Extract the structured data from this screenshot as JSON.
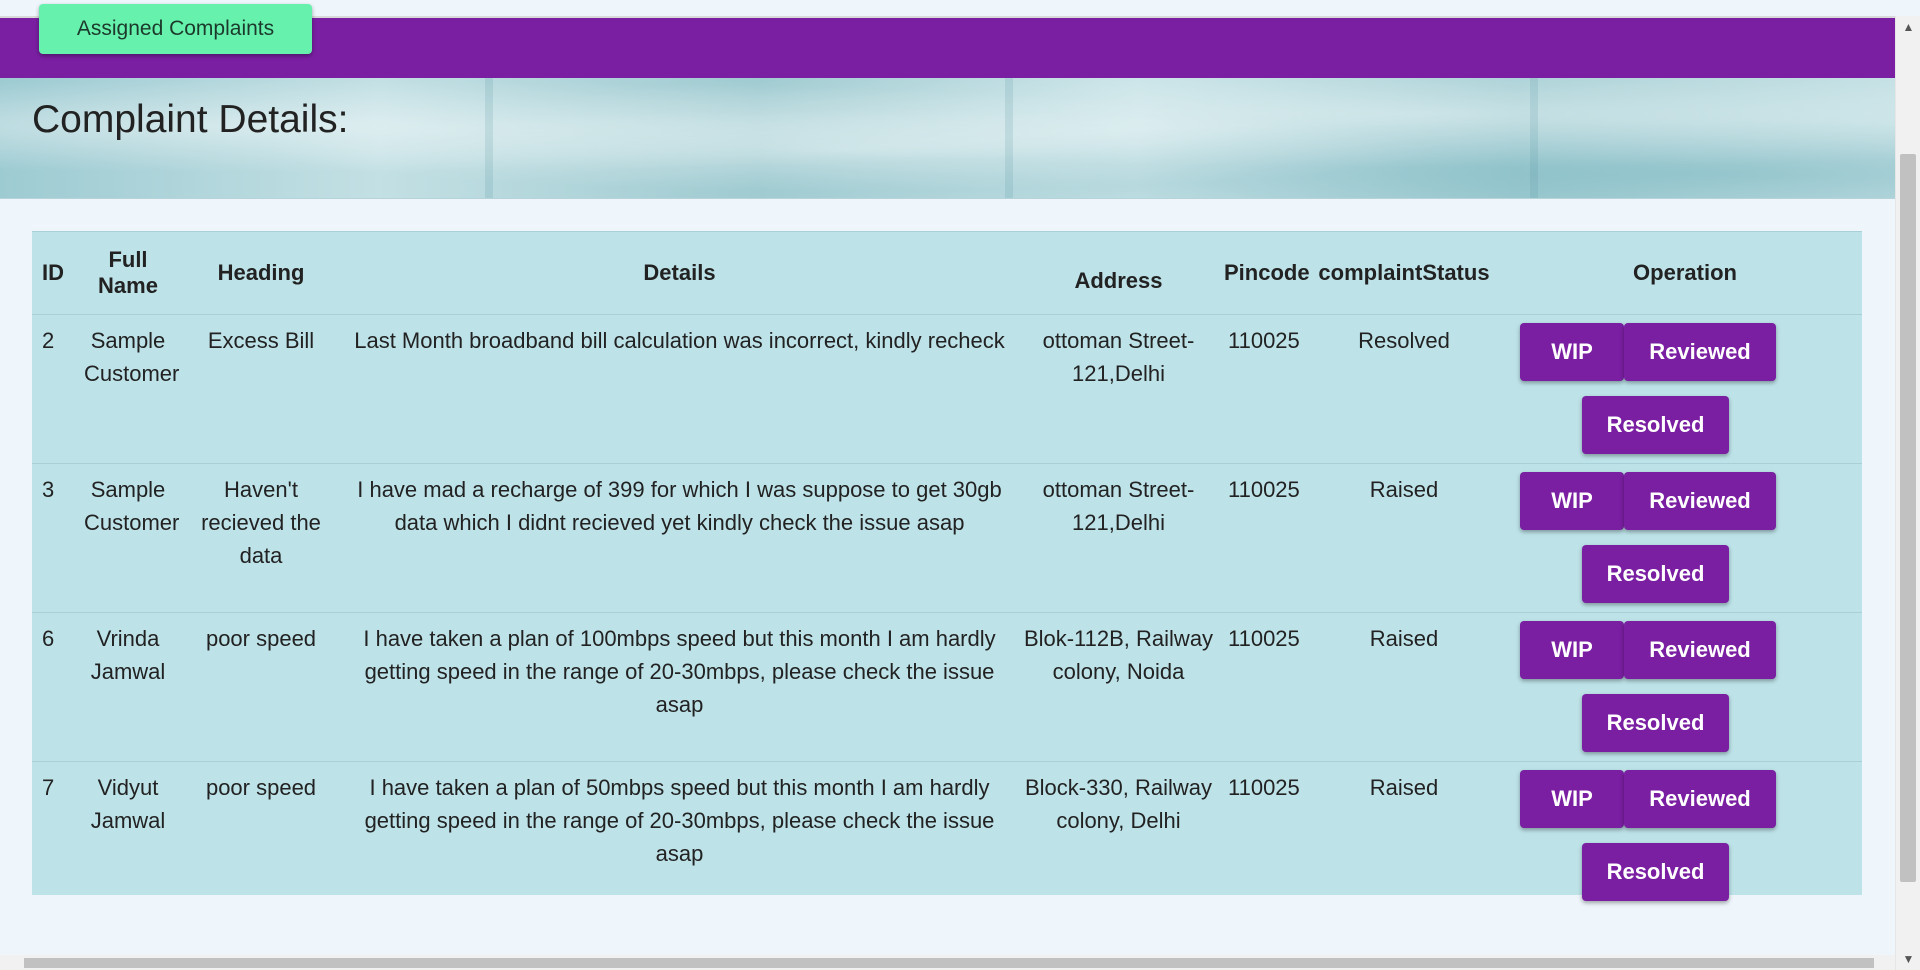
{
  "nav": {
    "assigned_button_label": "Assigned Complaints"
  },
  "page": {
    "title": "Complaint Details:"
  },
  "table": {
    "headers": {
      "id": "ID",
      "full_name": "Full Name",
      "heading": "Heading",
      "details": "Details",
      "address": "Address",
      "pincode": "Pincode",
      "status": "complaintStatus",
      "operation": "Operation"
    },
    "rows": [
      {
        "id": "2",
        "full_name": "Sample Customer",
        "heading": "Excess Bill",
        "details": "Last Month broadband bill calculation was incorrect, kindly recheck",
        "address": "ottoman Street-121,Delhi",
        "pincode": "110025",
        "status": "Resolved"
      },
      {
        "id": "3",
        "full_name": "Sample Customer",
        "heading": "Haven't recieved the data",
        "details": "I have mad a recharge of 399 for which I was suppose to get 30gb data which I didnt recieved yet kindly check the issue asap",
        "address": "ottoman Street-121,Delhi",
        "pincode": "110025",
        "status": "Raised"
      },
      {
        "id": "6",
        "full_name": "Vrinda Jamwal",
        "heading": "poor speed",
        "details": "I have taken a plan of 100mbps speed but this month I am hardly getting speed in the range of 20-30mbps, please check the issue asap",
        "address": "Blok-112B, Railway colony, Noida",
        "pincode": "110025",
        "status": "Raised"
      },
      {
        "id": "7",
        "full_name": "Vidyut Jamwal",
        "heading": "poor speed",
        "details": "I have taken a plan of 50mbps speed but this month I am hardly getting speed in the range of 20-30mbps, please check the issue asap",
        "address": "Block-330, Railway colony, Delhi",
        "pincode": "110025",
        "status": "Raised"
      }
    ],
    "operations": {
      "wip_label": "WIP",
      "reviewed_label": "Reviewed",
      "resolved_label": "Resolved"
    }
  },
  "icons": {
    "scroll_up": "scroll-up-arrow-icon",
    "scroll_down": "scroll-down-arrow-icon"
  },
  "colors": {
    "nav_bar": "#7a1fa2",
    "assigned_button": "#66f2ad",
    "table_background": "#bde3e9",
    "operation_button": "#7a1fa2",
    "page_background": "#eef6fc"
  }
}
